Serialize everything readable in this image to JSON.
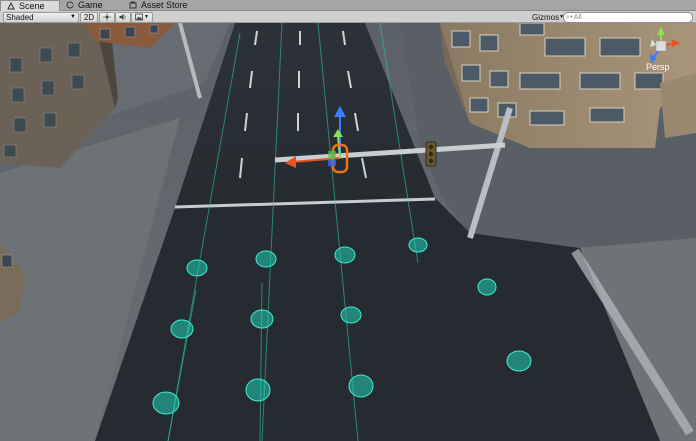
{
  "tabs": [
    {
      "label": "Scene",
      "icon": "scene-icon",
      "active": true
    },
    {
      "label": "Game",
      "icon": "game-icon",
      "active": false
    },
    {
      "label": "Asset Store",
      "icon": "asset-store-icon",
      "active": false
    }
  ],
  "toolbar": {
    "draw_mode": "Shaded",
    "two_d_label": "2D",
    "lighting_icon": "sun-icon",
    "audio_icon": "speaker-icon",
    "effects_icon": "image-effects-icon",
    "gizmos_label": "Gizmos",
    "search_placeholder": "All"
  },
  "scene": {
    "orientation_gizmo_label": "Persp",
    "axis_colors": {
      "x": "#e0481f",
      "y": "#7ee04a",
      "z": "#2f6fe0"
    }
  }
}
